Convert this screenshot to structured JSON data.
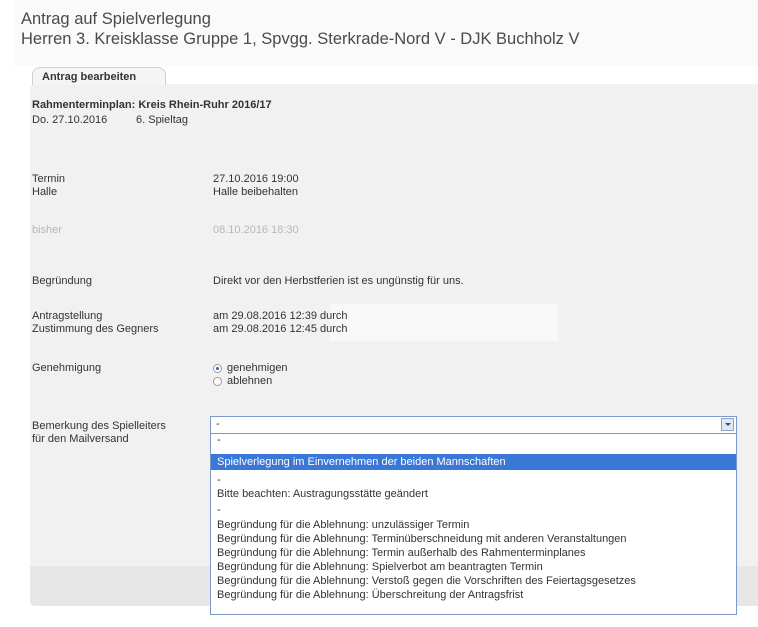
{
  "page": {
    "title_line1": "Antrag auf Spielverlegung",
    "title_line2": "Herren 3. Kreisklasse Gruppe 1, Spvgg. Sterkrade-Nord V - DJK Buchholz V"
  },
  "form": {
    "tab_label": "Antrag bearbeiten",
    "plan_title": "Rahmenterminplan: Kreis Rhein-Ruhr 2016/17",
    "plan_date": "Do. 27.10.2016",
    "plan_matchday": "6. Spieltag",
    "termin_label": "Termin",
    "termin_value": "27.10.2016 19:00",
    "halle_label": "Halle",
    "halle_value": "Halle beibehalten",
    "bisher_label": "bisher",
    "bisher_value": "08.10.2016 18:30",
    "begruendung_label": "Begründung",
    "begruendung_value": "Direkt vor den Herbstferien ist es ungünstig für uns.",
    "antrag_label": "Antragstellung",
    "antrag_value": "am 29.08.2016 12:39 durch",
    "zustimmung_label": "Zustimmung des Gegners",
    "zustimmung_value": "am 29.08.2016 12:45 durch",
    "genehmigung_label": "Genehmigung",
    "radio_approve": "genehmigen",
    "radio_reject": "ablehnen",
    "bemerkung_label_1": "Bemerkung des Spielleiters",
    "bemerkung_label_2": "für den Mailversand",
    "select_value": "-"
  },
  "dropdown_options": [
    "-",
    "Spielverlegung im Einvernehmen der beiden Mannschaften",
    "-",
    "Bitte beachten: Austragungsstätte geändert",
    "-",
    "Begründung für die Ablehnung: unzulässiger Termin",
    "Begründung für die Ablehnung: Terminüberschneidung mit anderen Veranstaltungen",
    "Begründung für die Ablehnung: Termin außerhalb des Rahmenterminplanes",
    "Begründung für die Ablehnung: Spielverbot am beantragten Termin",
    "Begründung für die Ablehnung: Verstoß gegen die Vorschriften des Feiertagsgesetzes",
    "Begründung für die Ablehnung: Überschreitung der Antragsfrist"
  ],
  "colors": {
    "selected_option_bg": "#3a77d6",
    "panel_bg": "#f1f1f1"
  }
}
